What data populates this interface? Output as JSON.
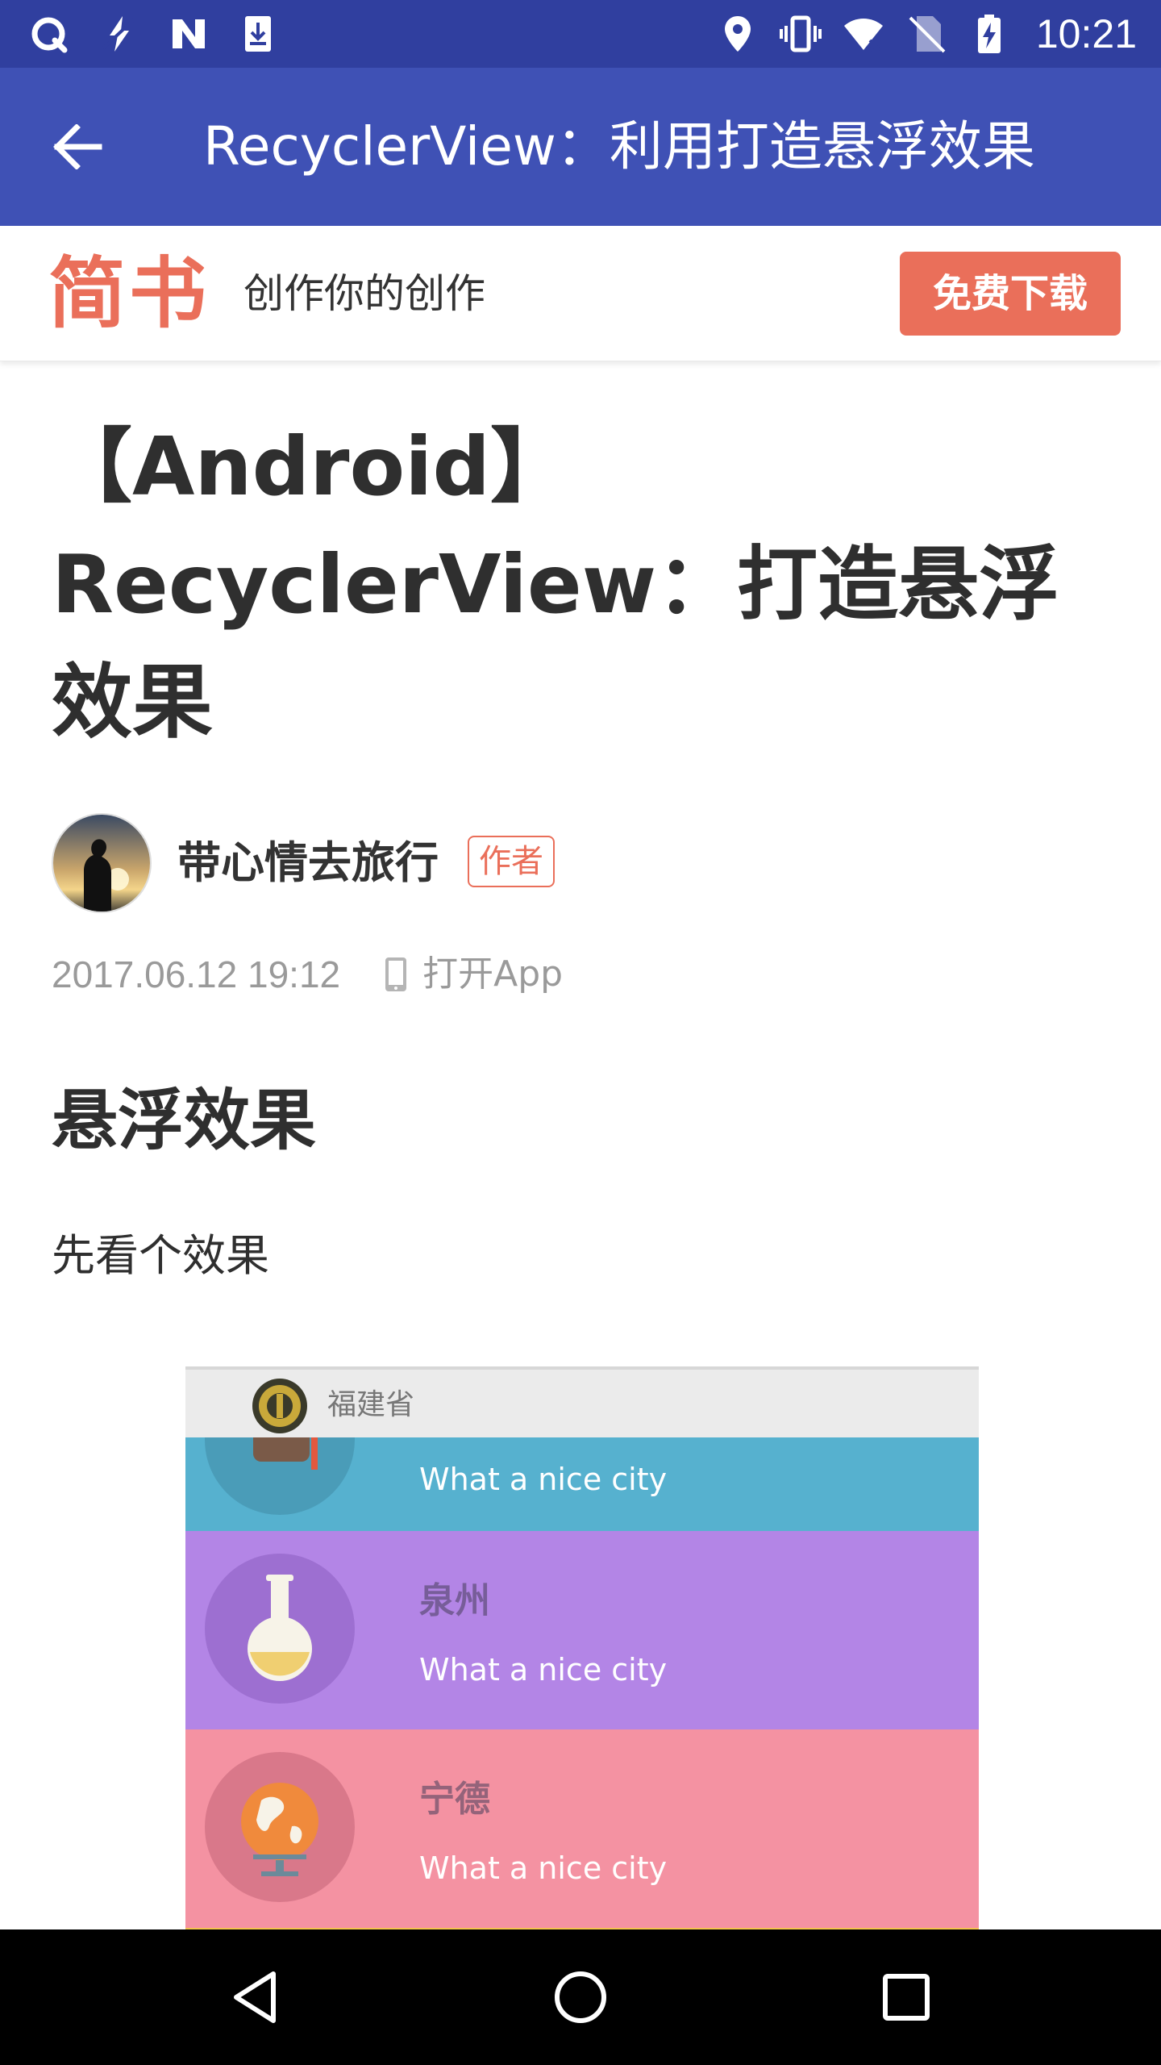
{
  "status_bar": {
    "time": "10:21",
    "left_icons": [
      "notification-app-icon",
      "battery-saver-bolt-icon",
      "nfc-icon",
      "download-icon"
    ],
    "right_icons": [
      "location-icon",
      "vibrate-icon",
      "wifi-icon",
      "no-sim-icon",
      "battery-charging-icon"
    ]
  },
  "app_bar": {
    "title": "RecyclerView：利用打造悬浮效果",
    "back_icon": "arrow-back-icon"
  },
  "banner": {
    "logo": "简书",
    "slogan": "创作你的创作",
    "download_label": "免费下载",
    "accent_color": "#ea6f5a"
  },
  "article": {
    "title": "【Android】RecyclerView：打造悬浮效果",
    "author": "带心情去旅行",
    "author_badge": "作者",
    "date": "2017.06.12 19:12",
    "open_app": "打开App",
    "section_heading": "悬浮效果",
    "paragraph": "先看个效果"
  },
  "demo_image": {
    "header": "福建省",
    "rows": [
      {
        "city": "",
        "tagline": "What a nice city",
        "color": "#56b1cf"
      },
      {
        "city": "泉州",
        "tagline": "What a nice city",
        "color": "#b385e6"
      },
      {
        "city": "宁德",
        "tagline": "What a nice city",
        "color": "#f492a2"
      }
    ]
  },
  "nav_bar": {
    "icons": [
      "nav-back-icon",
      "nav-home-icon",
      "nav-recents-icon"
    ]
  },
  "colors": {
    "status_bar": "#303f9f",
    "app_bar": "#3f51b5",
    "brand": "#ea6f5a"
  }
}
